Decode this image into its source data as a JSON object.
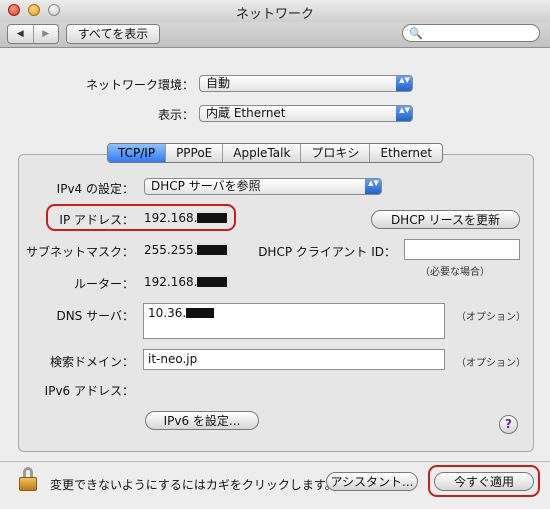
{
  "window": {
    "title": "ネットワーク"
  },
  "toolbar": {
    "back_glyph": "◀",
    "forward_glyph": "▶",
    "show_all_label": "すべてを表示",
    "search_icon": "🔍",
    "search_value": "",
    "search_placeholder": ""
  },
  "location": {
    "label": "ネットワーク環境：",
    "value": "自動"
  },
  "show": {
    "label": "表示：",
    "value": "内蔵 Ethernet"
  },
  "popup_arrow": "▲▼",
  "tabs": [
    {
      "label": "TCP/IP",
      "active": true
    },
    {
      "label": "PPPoE"
    },
    {
      "label": "AppleTalk"
    },
    {
      "label": "プロキシ"
    },
    {
      "label": "Ethernet"
    }
  ],
  "ipv4": {
    "label": "IPv4 の設定：",
    "value": "DHCP サーバを参照"
  },
  "ip_address": {
    "label": "IP アドレス：",
    "value": "192.168."
  },
  "renew_button": "DHCP リースを更新",
  "subnet": {
    "label": "サブネットマスク：",
    "value": "255.255."
  },
  "dhcp_client": {
    "label": "DHCP クライアント ID：",
    "value": "",
    "hint": "（必要な場合）"
  },
  "router": {
    "label": "ルーター：",
    "value": "192.168."
  },
  "dns": {
    "label": "DNS サーバ：",
    "value": "10.36.",
    "hint": "（オプション）"
  },
  "search_domain": {
    "label": "検索ドメイン：",
    "value": "it-neo.jp",
    "hint": "（オプション）"
  },
  "ipv6": {
    "label": "IPv6 アドレス：",
    "button": "IPv6 を設定..."
  },
  "help_glyph": "?",
  "footer": {
    "lock_text": "変更できないようにするにはカギをクリックします。",
    "assistant_button": "アシスタント...",
    "apply_button": "今すぐ適用"
  },
  "colors": {
    "highlight_ring": "#c61d1d",
    "active_tab": "#2f7cf1",
    "popup_arrow": "#1c5ccc"
  }
}
